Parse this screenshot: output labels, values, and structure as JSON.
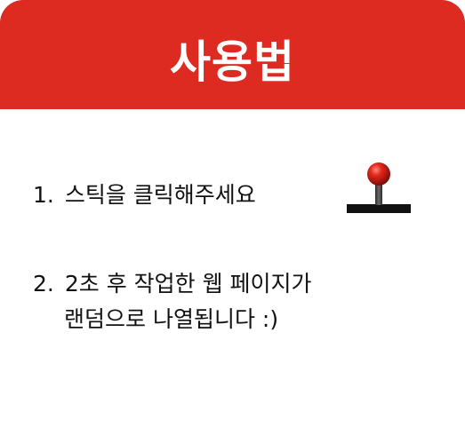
{
  "header": {
    "title": "사용법",
    "color": "#dd2b22"
  },
  "steps": [
    {
      "number": "1.",
      "text": "스틱을 클릭해주세요"
    },
    {
      "number": "2.",
      "text": "2초 후 작업한 웹 페이지가",
      "continuation": "랜덤으로 나열됩니다 :)"
    }
  ],
  "icon": "joystick-icon"
}
